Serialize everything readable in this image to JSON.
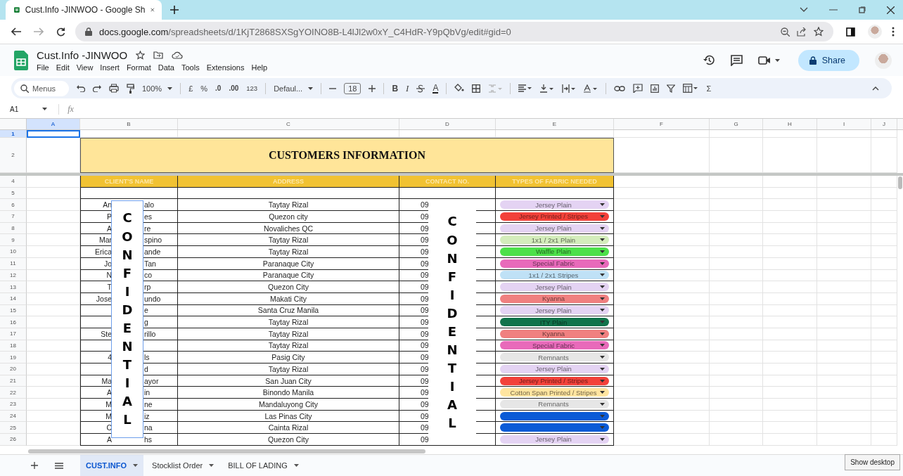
{
  "browser": {
    "tab_title": "Cust.Info -JINWOO - Google Sh",
    "url_host": "docs.google.com",
    "url_path": "/spreadsheets/d/1KjT2868SXSgYOINO8B-L4lJl2w0xY_C4HdR-Y9pQbVg/edit#gid=0"
  },
  "doc": {
    "title": "Cust.Info -JINWOO",
    "menu": [
      "File",
      "Edit",
      "View",
      "Insert",
      "Format",
      "Data",
      "Tools",
      "Extensions",
      "Help"
    ],
    "share": "Share"
  },
  "toolbar": {
    "search_placeholder": "Menus",
    "zoom": "100%",
    "currency": "£",
    "percent": "%",
    "decrease_decimal": ".0",
    "increase_decimal": ".00",
    "number_format": "123",
    "font": "Defaul...",
    "font_size": "18",
    "bold": "B",
    "italic": "I",
    "text_color": "A",
    "functions": "Σ"
  },
  "formula_bar": {
    "cell_ref": "A1",
    "fx": "fx"
  },
  "columns": [
    {
      "label": "A",
      "selected": true
    },
    {
      "label": "B",
      "selected": false
    },
    {
      "label": "C",
      "selected": false
    },
    {
      "label": "D",
      "selected": false
    },
    {
      "label": "E",
      "selected": false
    },
    {
      "label": "F",
      "selected": false
    },
    {
      "label": "G",
      "selected": false
    },
    {
      "label": "H",
      "selected": false
    },
    {
      "label": "I",
      "selected": false
    },
    {
      "label": "J",
      "selected": false
    }
  ],
  "sheet": {
    "row_1": {
      "number": "1",
      "selected": true
    },
    "title_row": {
      "number": "2",
      "title": "CUSTOMERS INFORMATION"
    },
    "header_row": {
      "number": "4",
      "headers": [
        "CLIENT'S NAME",
        "ADDRESS",
        "CONTACT NO.",
        "TYPES OF FABRIC NEEDED"
      ]
    },
    "rows": [
      {
        "number": "5"
      },
      {
        "number": "6",
        "name_start": "An",
        "name_end": "alo",
        "address": "Taytay Rizal",
        "contact": "09",
        "fabric": {
          "label": "Jersey Plain",
          "color": "#e4d3f3"
        }
      },
      {
        "number": "7",
        "name_start": "P",
        "name_end": "es",
        "address": "Quezon city",
        "contact": "09",
        "fabric": {
          "label": "Jersey Printed / Stripes",
          "color": "#f2413a"
        }
      },
      {
        "number": "8",
        "name_start": "A",
        "name_end": "re",
        "address": "Novaliches QC",
        "contact": "09",
        "fabric": {
          "label": "Jersey Plain",
          "color": "#e4d3f3"
        }
      },
      {
        "number": "9",
        "name_start": "Mar",
        "name_end": "spino",
        "address": "Taytay Rizal",
        "contact": "09",
        "fabric": {
          "label": "1x1 / 2x1 Plain",
          "color": "#d4edbc"
        }
      },
      {
        "number": "10",
        "name_start": "Erica",
        "name_end": "ande",
        "address": "Taytay Rizal",
        "contact": "09",
        "fabric": {
          "label": "Waffle Plain",
          "color": "#4de04a"
        }
      },
      {
        "number": "11",
        "name_start": "Jo",
        "name_end": "Tan",
        "address": "Paranaque City",
        "contact": "09",
        "fabric": {
          "label": "Special Fabric",
          "color": "#e86aba"
        }
      },
      {
        "number": "12",
        "name_start": "N",
        "name_end": "co",
        "address": "Paranaque City",
        "contact": "09",
        "fabric": {
          "label": "1x1 / 2x1 Stripes",
          "color": "#bfe1f6"
        }
      },
      {
        "number": "13",
        "name_start": "T",
        "name_end": "rp",
        "address": "Quezon City",
        "contact": "09",
        "fabric": {
          "label": "Jersey Plain",
          "color": "#e4d3f3"
        }
      },
      {
        "number": "14",
        "name_start": "Jose",
        "name_end": "undo",
        "address": "Makati City",
        "contact": "09",
        "fabric": {
          "label": "Kyanna",
          "color": "#f08080"
        }
      },
      {
        "number": "15",
        "name_end": "e",
        "address": "Santa Cruz Manila",
        "contact": "09",
        "fabric": {
          "label": "Jersey Plain",
          "color": "#e4d3f3"
        }
      },
      {
        "number": "16",
        "name_end": "g",
        "address": "Taytay Rizal",
        "contact": "09",
        "fabric": {
          "label": "ITY Plain",
          "color": "#11734b"
        }
      },
      {
        "number": "17",
        "name_start": "Ste",
        "name_end": "rillo",
        "address": "Taytay Rizal",
        "contact": "09",
        "fabric": {
          "label": "Kyanna",
          "color": "#f08080"
        }
      },
      {
        "number": "18",
        "address": "Taytay Rizal",
        "contact": "09",
        "fabric": {
          "label": "Special Fabric",
          "color": "#e86aba"
        }
      },
      {
        "number": "19",
        "name_start": "4",
        "name_end": "ls",
        "address": "Pasig City",
        "contact": "09",
        "fabric": {
          "label": "Remnants",
          "color": "#e6e6e6"
        }
      },
      {
        "number": "20",
        "name_end": "d",
        "address": "Taytay Rizal",
        "contact": "09",
        "fabric": {
          "label": "Jersey Plain",
          "color": "#e4d3f3"
        }
      },
      {
        "number": "21",
        "name_start": "Ma",
        "name_end": "ayor",
        "address": "San Juan City",
        "contact": "09",
        "fabric": {
          "label": "Jersey Printed / Stripes",
          "color": "#f2413a"
        }
      },
      {
        "number": "22",
        "name_start": "A",
        "name_end": "in",
        "address": "Binondo Manila",
        "contact": "09",
        "fabric": {
          "label": "Cotton Span Printed / Stripes",
          "color": "#ffe5a0"
        }
      },
      {
        "number": "23",
        "name_start": "M",
        "name_end": "ne",
        "address": "Mandaluyong City",
        "contact": "09",
        "fabric": {
          "label": "Remnants",
          "color": "#e6e6e6"
        }
      },
      {
        "number": "24",
        "name_start": "M",
        "name_end": "iz",
        "address": "Las Pinas City",
        "contact": "09",
        "fabric": {
          "color": "#0b5bd6"
        }
      },
      {
        "number": "25",
        "name_start": "C",
        "name_end": "na",
        "address": "Cainta Rizal",
        "contact": "09",
        "fabric": {
          "color": "#0b5bd6"
        }
      },
      {
        "number": "26",
        "name_start": "A",
        "name_end": "hs",
        "address": "Quezon City",
        "contact": "09",
        "fabric": {
          "label": "Jersey Plain",
          "color": "#e4d3f3"
        }
      }
    ]
  },
  "redaction_labels": [
    "CONFIDENTIAL",
    "CONFIDENTIAL"
  ],
  "sheet_tabs": [
    {
      "label": "CUST.INFO",
      "selected": true
    },
    {
      "label": "Stocklist Order",
      "selected": false
    },
    {
      "label": "BILL OF LADING",
      "selected": false
    }
  ],
  "tooltip": "Show desktop"
}
